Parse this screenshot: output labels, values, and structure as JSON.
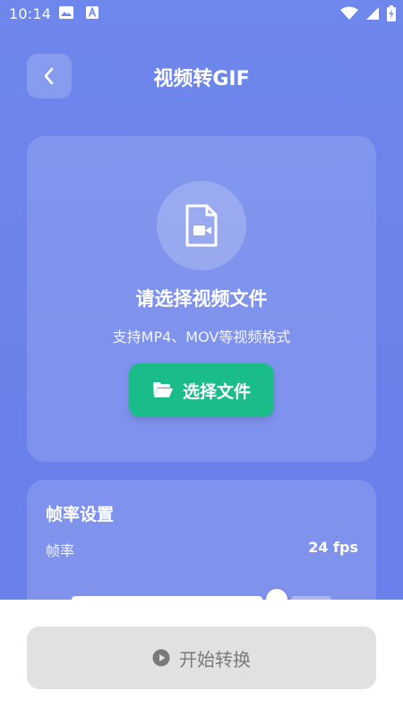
{
  "status_bar": {
    "time": "10:14",
    "icons": [
      "image-icon",
      "font-a-icon",
      "wifi-icon",
      "signal-icon",
      "battery-charging-icon"
    ]
  },
  "header": {
    "title": "视频转GIF",
    "back_icon": "chevron-left-icon"
  },
  "select_card": {
    "icon": "video-file-icon",
    "title": "请选择视频文件",
    "subtitle": "支持MP4、MOV等视频格式",
    "button_label": "选择文件",
    "button_icon": "folder-open-icon",
    "button_color": "#1abc8a"
  },
  "fps_card": {
    "title": "帧率设置",
    "label": "帧率",
    "value": "24 fps",
    "slider_fraction": 0.79
  },
  "bottom": {
    "start_label": "开始转换",
    "start_icon": "play-circle-icon",
    "start_disabled": true
  },
  "colors": {
    "background": "#6e87ec",
    "accent_green": "#1abc8a",
    "disabled_button": "#e1e1e1"
  }
}
